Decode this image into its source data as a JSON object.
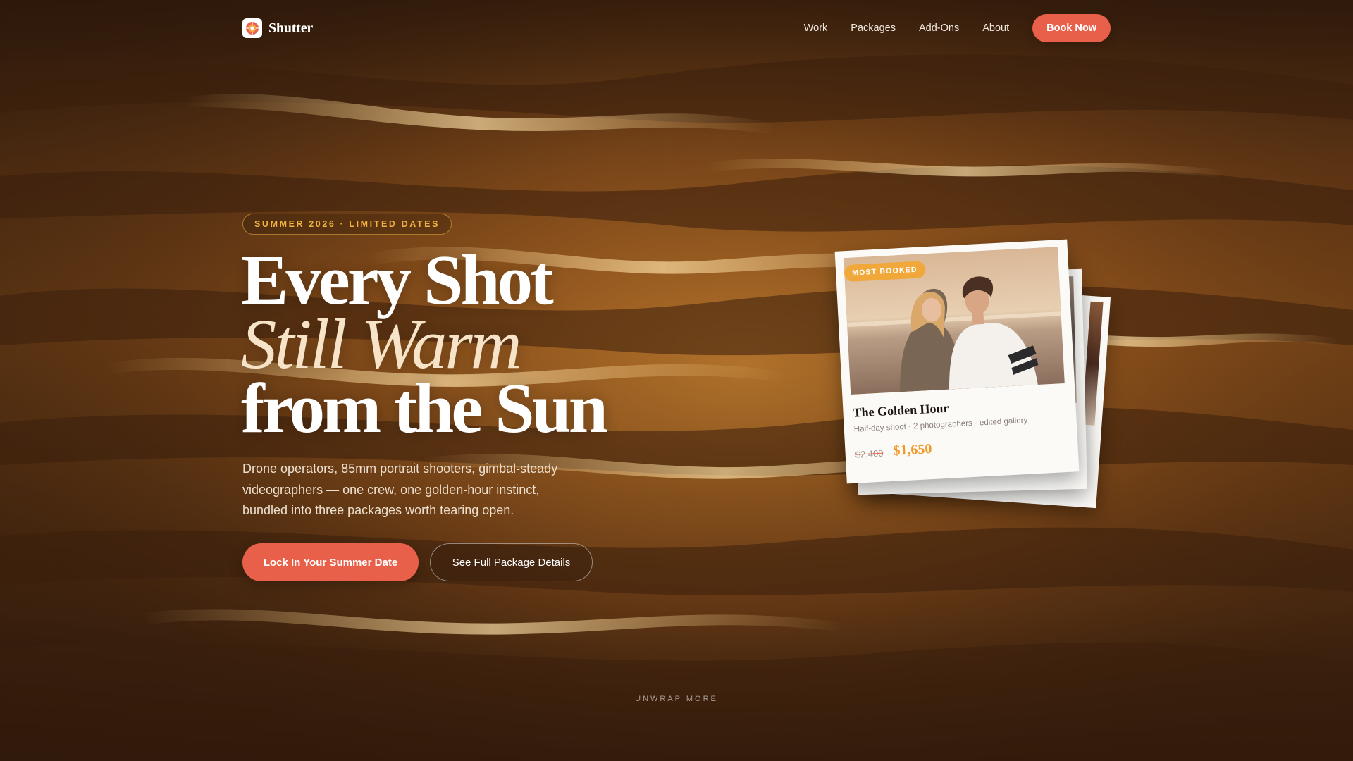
{
  "nav": {
    "brand": "Shutter",
    "links": [
      "Work",
      "Packages",
      "Add-Ons",
      "About"
    ],
    "book_label": "Book Now"
  },
  "hero": {
    "badge": "SUMMER 2026 · LIMITED DATES",
    "headline_line1": "Every Shot",
    "headline_line2": "Still Warm",
    "headline_line3": "from the Sun",
    "lede": "Drone operators, 85mm portrait shooters, gimbal-steady videographers — one crew, one golden-hour instinct, bundled into three packages worth tearing open.",
    "cta_primary": "Lock In Your Summer Date",
    "cta_secondary": "See Full Package Details"
  },
  "package_card": {
    "tag": "MOST BOOKED",
    "title": "The Golden Hour",
    "subtitle": "Half-day shoot · 2 photographers · edited gallery",
    "old_price": "$2,400",
    "new_price": "$1,650"
  },
  "scroll_hint": "UNWRAP MORE",
  "colors": {
    "accent": "#e9604a",
    "gold": "#f2b03e",
    "price": "#f09a2a",
    "background": "#6a3c16"
  },
  "icons": {
    "logo": "camera-aperture-icon"
  }
}
